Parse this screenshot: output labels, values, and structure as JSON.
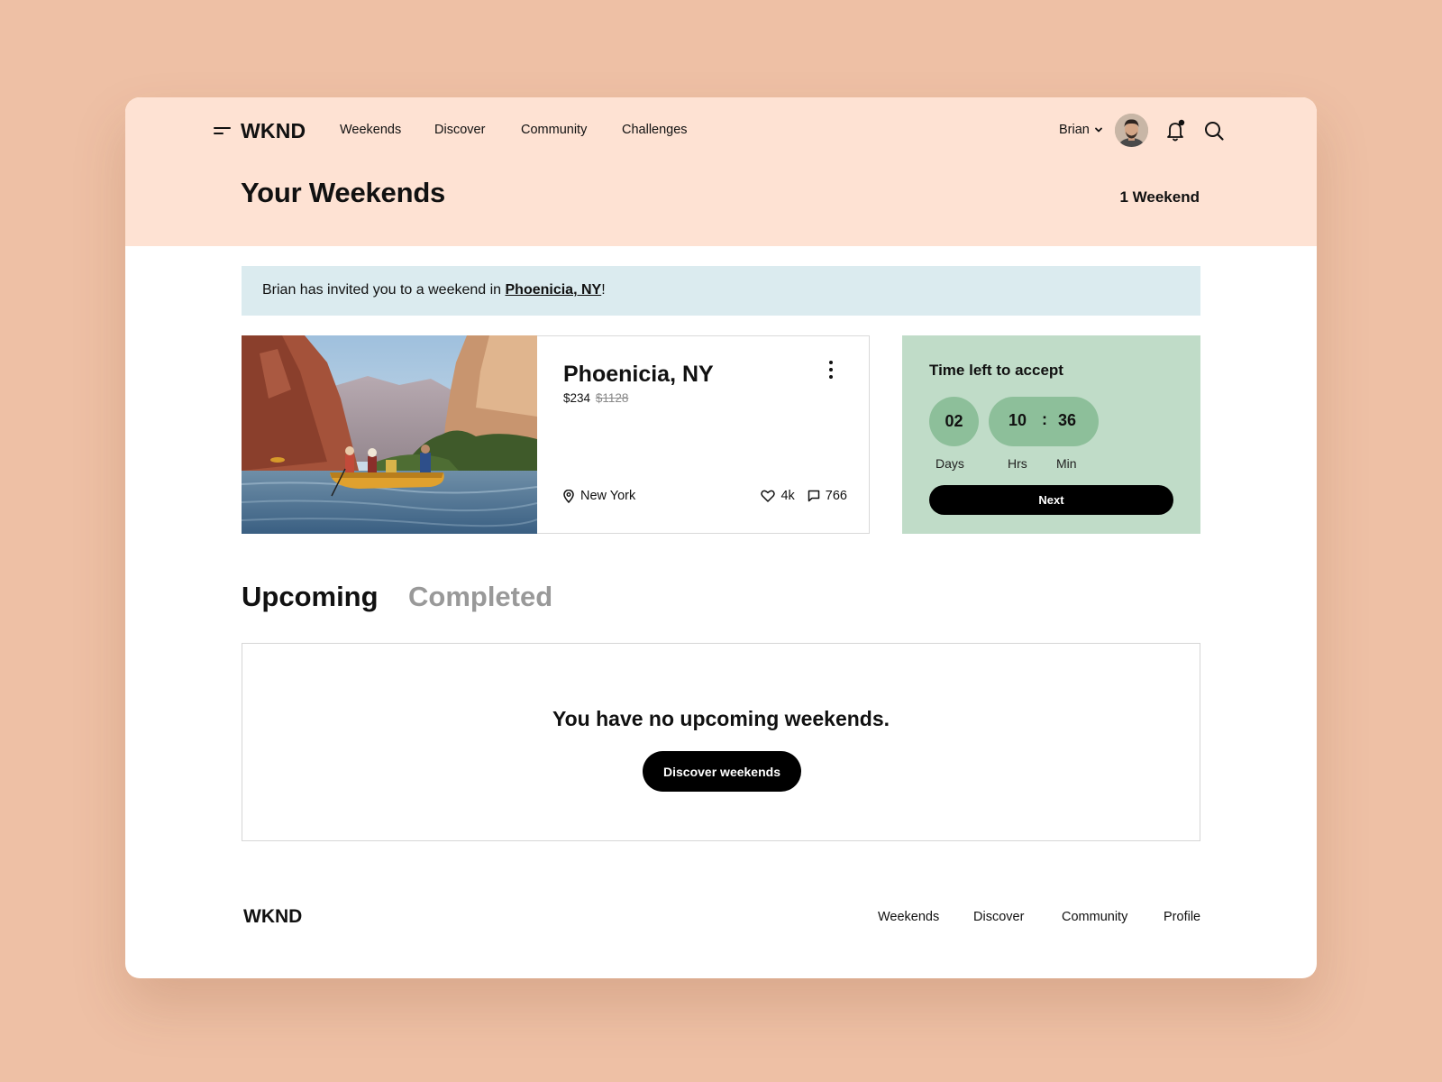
{
  "app": {
    "logo": "WKND"
  },
  "nav": {
    "links": [
      "Weekends",
      "Discover",
      "Community",
      "Challenges"
    ],
    "user_name": "Brian"
  },
  "header": {
    "title": "Your Weekends",
    "count": "1 Weekend"
  },
  "invite": {
    "text_before": "Brian has invited you to a weekend in ",
    "place": "Phoenicia, NY",
    "text_after": "!"
  },
  "trip": {
    "title": "Phoenicia, NY",
    "price": "$234",
    "old_price": "$1128",
    "location": "New York",
    "likes": "4k",
    "comments": "766"
  },
  "countdown": {
    "title": "Time left to accept",
    "days": "02",
    "hours": "10",
    "separator": ":",
    "minutes": "36",
    "days_label": "Days",
    "hours_label": "Hrs",
    "minutes_label": "Min",
    "next_label": "Next"
  },
  "tabs": [
    "Upcoming",
    "Completed"
  ],
  "empty_state": {
    "message": "You have no upcoming weekends.",
    "button": "Discover weekends"
  },
  "footer": {
    "logo": "WKND",
    "links": [
      "Weekends",
      "Discover",
      "Community",
      "Profile"
    ]
  },
  "colors": {
    "page_bg": "#eec0a5",
    "hero_bg": "#fee2d3",
    "invite_bg": "#dbebef",
    "countdown_bg": "#c0dcc8",
    "countdown_pill": "#8dbf9a",
    "button": "#000000"
  }
}
